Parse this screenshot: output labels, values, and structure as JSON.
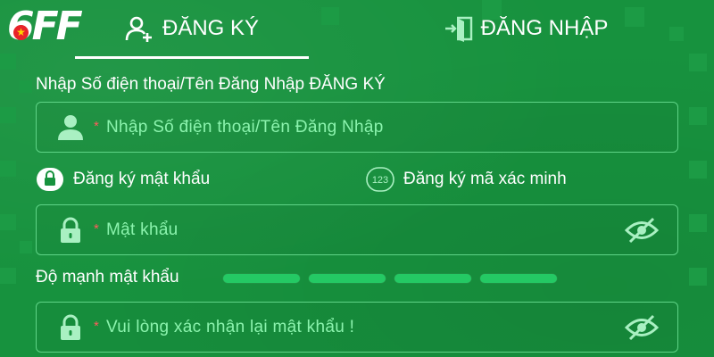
{
  "brand": {
    "logo_text": "6FF"
  },
  "tabs": {
    "register_label": "ĐĂNG KÝ",
    "login_label": "ĐĂNG NHẬP",
    "active": "register"
  },
  "form": {
    "title": "Nhập Số điện thoại/Tên Đăng Nhập ĐĂNG KÝ",
    "username": {
      "required_mark": "*",
      "placeholder": "Nhập Số điện thoại/Tên Đăng Nhập",
      "value": ""
    },
    "modes": {
      "password_label": "Đăng ký mật khẩu",
      "code_label": "Đăng ký mã xác minh",
      "code_badge": "123",
      "selected": "password"
    },
    "password": {
      "required_mark": "*",
      "placeholder": "Mật khẩu",
      "value": ""
    },
    "strength": {
      "label": "Độ mạnh mật khẩu",
      "segments": 4,
      "filled": 0
    },
    "confirm": {
      "required_mark": "*",
      "placeholder": "Vui lòng xác nhận lại mật khẩu !",
      "value": ""
    }
  },
  "icons": {
    "user": "user-icon",
    "lock": "lock-icon",
    "eye_off": "eye-off-icon",
    "register_tab": "add-user-icon",
    "login_tab": "login-door-icon",
    "code_badge": "number-badge-icon"
  },
  "colors": {
    "background": "#17923e",
    "field_border": "#5fd487",
    "placeholder": "#8bf3ad",
    "icon": "#a9f0c2",
    "required": "#ff5c5c",
    "strength_bar": "#24c964"
  }
}
